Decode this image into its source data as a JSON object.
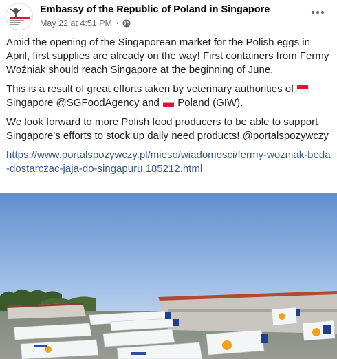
{
  "post": {
    "page_name": "Embassy of the Republic of Poland in Singapore",
    "date": "May 22 at 4:51 PM",
    "separator": "·",
    "privacy_icon": "globe-icon",
    "more_icon": "more-options-icon",
    "paragraph1": "Amid the opening of the Singaporean market for the Polish eggs in April, first supplies are already on the way! First containers from Fermy Woźniak should reach Singapore at the beginning of June.",
    "paragraph2_start": "This is a result of great efforts taken by veterinary authorities of",
    "paragraph2_mid": "Singapore @SGFoodAgency and",
    "paragraph2_end": "Poland (GIW).",
    "paragraph3": "We look forward to more Polish food producers to be able to support Singapore's efforts to stock up daily need products! @portalspozywczy",
    "link_url": "https://www.portalspozywczy.pl/mieso/wiadomosci/fermy-wozniak-beda-dostarczac-jaja-do-singapuru,185212.html"
  },
  "colors": {
    "link": "#385898",
    "meta_text": "#65676b",
    "singapore_red": "#e8112d",
    "poland_red": "#dc143c"
  }
}
